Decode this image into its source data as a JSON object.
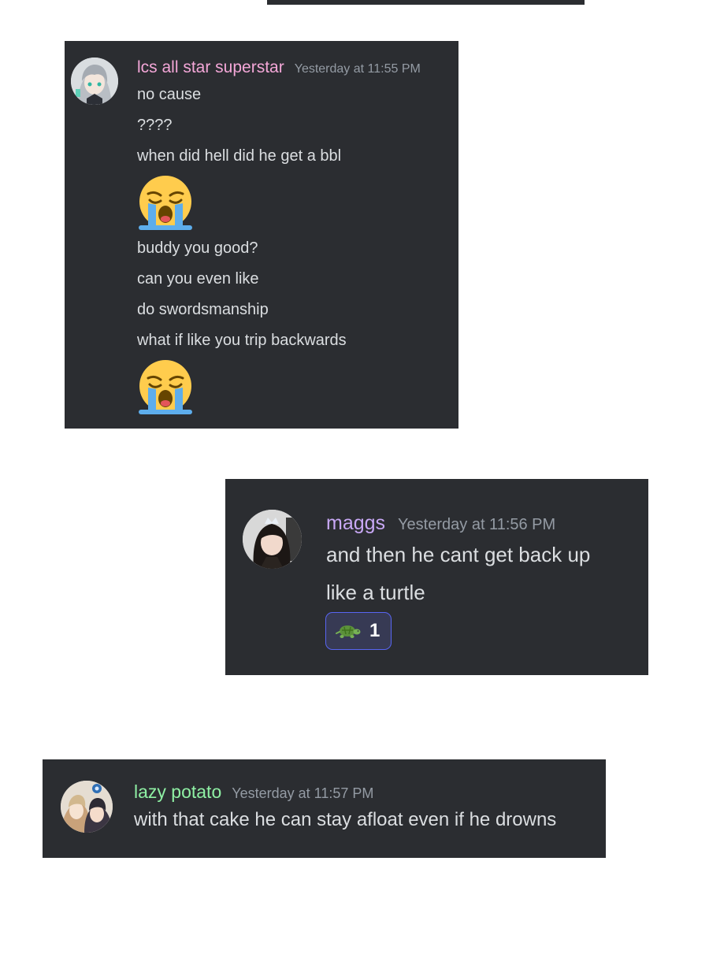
{
  "colors": {
    "card_bg": "#2b2d31",
    "page_bg": "#ffffff",
    "text": "#dbdee1",
    "timestamp": "#949ba4",
    "reaction_border": "#5865f2",
    "reaction_bg": "#373a54"
  },
  "messages": [
    {
      "username": "lcs all star superstar",
      "username_color": "#f4a7d8",
      "timestamp": "Yesterday at 11:55 PM",
      "avatar": "anime-avatar-silver-hair-icon",
      "lines": [
        "no cause",
        "????",
        "when did hell did he get a bbl",
        "buddy you good?",
        "can you even like",
        "do swordsmanship",
        "what if like you trip backwards"
      ],
      "emojis": [
        "loudly-crying-face-icon",
        "loudly-crying-face-icon"
      ]
    },
    {
      "username": "maggs",
      "username_color": "#c8a8f5",
      "timestamp": "Yesterday at 11:56 PM",
      "avatar": "girl-with-tiara-avatar-icon",
      "lines": [
        "and then he cant get back up",
        "like a turtle"
      ],
      "reaction": {
        "icon": "turtle-icon",
        "count": "1"
      }
    },
    {
      "username": "lazy potato",
      "username_color": "#8ff0a4",
      "timestamp": "Yesterday at 11:57 PM",
      "avatar": "anime-duo-avatar-icon",
      "lines": [
        "with that cake he can stay afloat even if he drowns"
      ]
    }
  ]
}
